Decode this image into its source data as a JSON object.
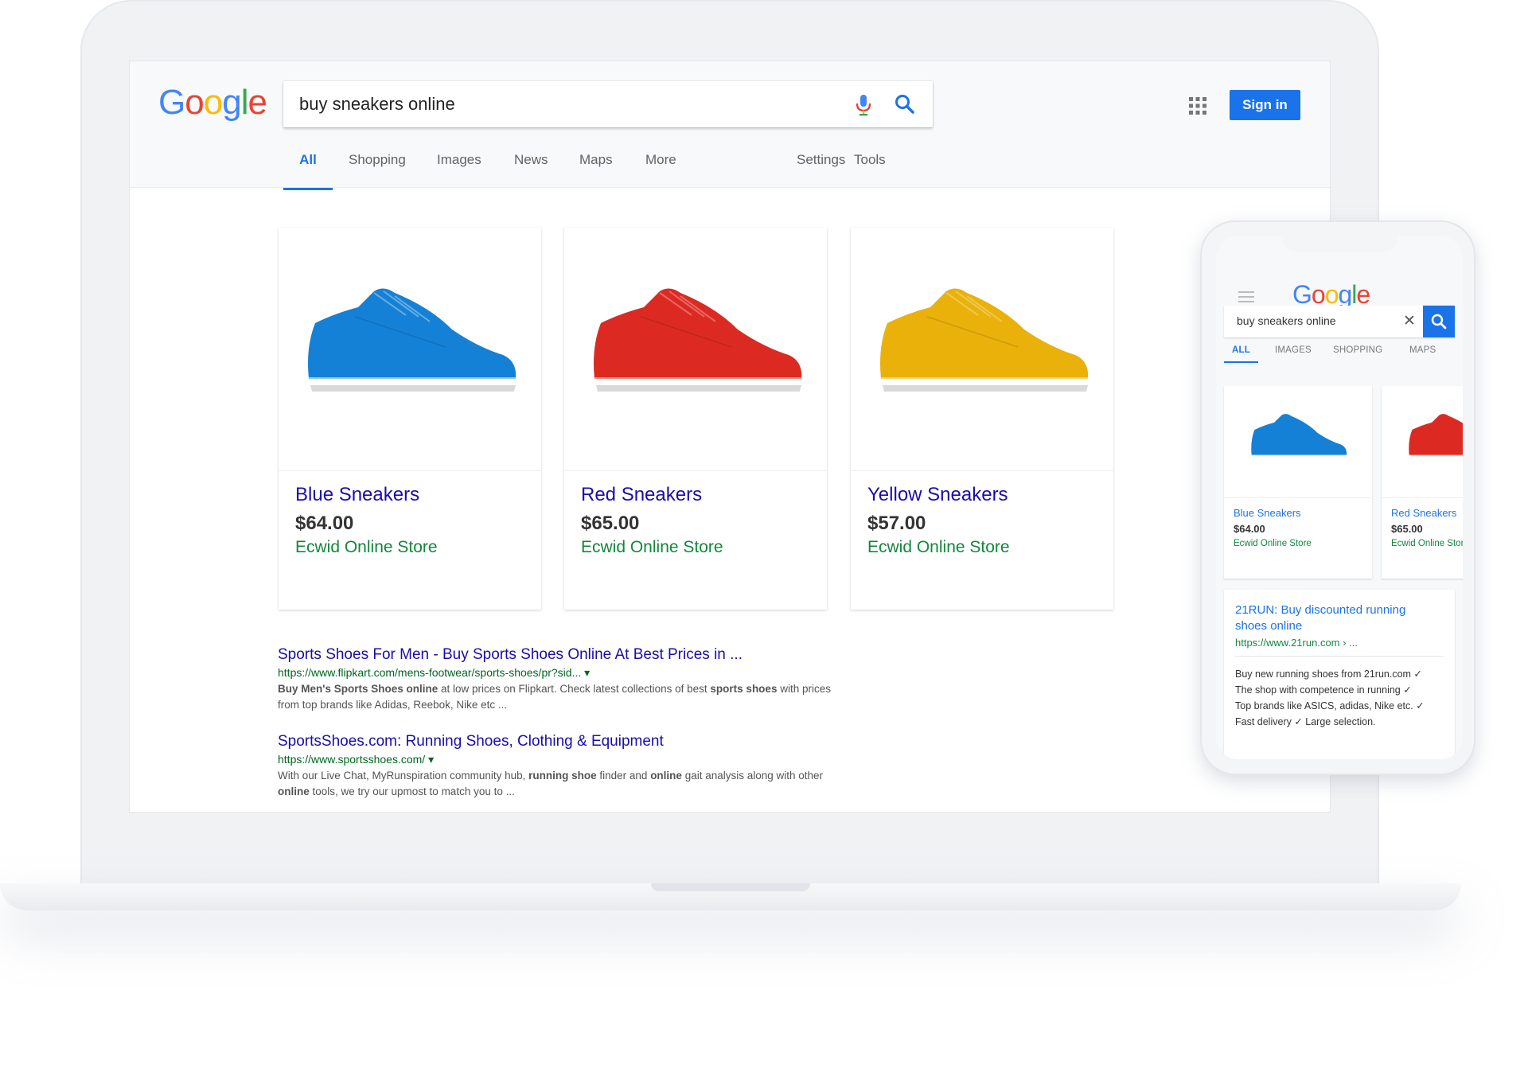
{
  "colors": {
    "accent": "#1a73e8",
    "link": "#1a0dab",
    "url_green": "#006621",
    "store_green": "#13863c",
    "logo_blue": "#4285f4",
    "logo_red": "#ea4335",
    "logo_yellow": "#fbbc05",
    "logo_green": "#34a853",
    "sneaker_blue": "#1581d6",
    "sneaker_red": "#dc2a22",
    "sneaker_yellow": "#e9b10a"
  },
  "desktop": {
    "logo": [
      "G",
      "o",
      "o",
      "g",
      "l",
      "e"
    ],
    "search": {
      "query": "buy sneakers online",
      "mic_icon": "microphone-icon",
      "search_icon": "magnifier-icon"
    },
    "apps_icon": "grid-apps-icon",
    "sign_in_label": "Sign in",
    "tabs": [
      {
        "label": "All",
        "active": true
      },
      {
        "label": "Shopping"
      },
      {
        "label": "Images"
      },
      {
        "label": "News"
      },
      {
        "label": "Maps"
      },
      {
        "label": "More"
      },
      {
        "label": "Settings"
      },
      {
        "label": "Tools"
      }
    ],
    "products": [
      {
        "title": "Blue Sneakers",
        "price": "$64.00",
        "store": "Ecwid Online Store"
      },
      {
        "title": "Red Sneakers",
        "price": "$65.00",
        "store": "Ecwid Online Store"
      },
      {
        "title": "Yellow Sneakers",
        "price": "$57.00",
        "store": "Ecwid Online Store"
      }
    ],
    "results": [
      {
        "title": "Sports Shoes For Men - Buy Sports Shoes Online At Best Prices in ...",
        "url": "https://www.flipkart.com/mens-footwear/sports-shoes/pr?sid...",
        "snippet_parts": [
          {
            "t": "Buy Men's ",
            "b": true
          },
          {
            "t": "Sports Shoes online",
            "b": true
          },
          {
            "t": " at low prices on Flipkart. Check latest collections of best ",
            "b": false
          },
          {
            "t": "sports shoes",
            "b": true
          },
          {
            "t": " with prices from top brands like Adidas, Reebok, Nike etc ...",
            "b": false
          }
        ]
      },
      {
        "title": "SportsShoes.com: Running Shoes, Clothing & Equipment",
        "url": "https://www.sportsshoes.com/",
        "snippet_parts": [
          {
            "t": "With our Live Chat, MyRunspiration community hub, ",
            "b": false
          },
          {
            "t": "running shoe",
            "b": true
          },
          {
            "t": " finder and ",
            "b": false
          },
          {
            "t": "online",
            "b": true
          },
          {
            "t": " gait analysis along with other ",
            "b": false
          },
          {
            "t": "online",
            "b": true
          },
          {
            "t": " tools, we try our upmost to match you to ...",
            "b": false
          }
        ]
      }
    ]
  },
  "mobile": {
    "menu_icon": "hamburger-menu-icon",
    "logo": [
      "G",
      "o",
      "o",
      "g",
      "l",
      "e"
    ],
    "search": {
      "query": "buy sneakers online",
      "clear_label": "✕",
      "search_icon": "magnifier-icon"
    },
    "tabs": [
      {
        "label": "ALL",
        "active": true
      },
      {
        "label": "IMAGES"
      },
      {
        "label": "SHOPPING"
      },
      {
        "label": "MAPS"
      }
    ],
    "products": [
      {
        "title": "Blue Sneakers",
        "price": "$64.00",
        "store": "Ecwid Online Store"
      },
      {
        "title": "Red Sneakers",
        "price": "$65.00",
        "store": "Ecwid Online Store"
      }
    ],
    "result": {
      "title": "21RUN: Buy discounted running shoes online",
      "url": "https://www.21run.com › ...",
      "lines": [
        "Buy new running shoes from 21run.com ✓",
        "The shop with competence in running ✓",
        "Top brands like ASICS, adidas, Nike etc. ✓",
        "Fast delivery ✓ Large selection."
      ]
    }
  }
}
